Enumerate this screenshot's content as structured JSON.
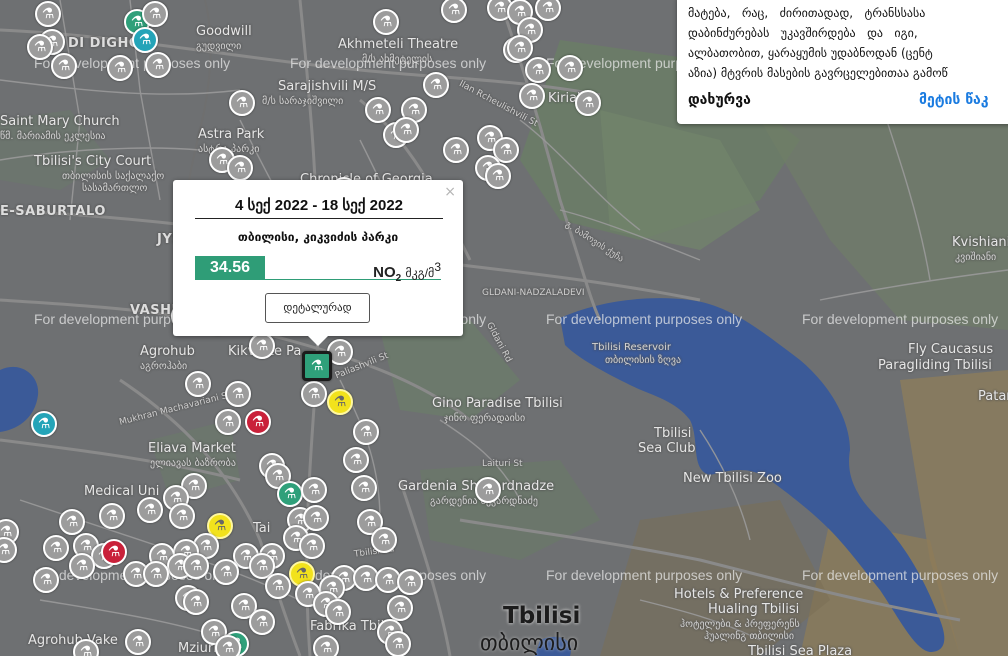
{
  "map": {
    "watermark_text": "For development purposes only",
    "labels": {
      "goodwill": "Goodwill",
      "goodwill_ka": "გუდვილი",
      "didi_dighomi": "DI DIGHO",
      "akhmeteli": "Akhmeteli Theatre",
      "akhmeteli_ka": "მ/ს ახმეტელის",
      "sarajishvili": "Sarajishvili M/S",
      "sarajishvili_ka": "მ/ს სარაჯიშვილი",
      "saint_mary": "Saint Mary Church",
      "saint_mary_ka": "წმ. მარიამის ეკლესია",
      "astra_park": "Astra Park",
      "astra_park_ka": "ასტრა პარკი",
      "city_court": "Tbilisi's City Court",
      "city_court_ka1": "თბილისის საქალაქო",
      "city_court_ka2": "სასამართლო",
      "chronicle": "Chronicle of Georgia",
      "saburtalo": "E-SABURTALO",
      "vashlijvari": "VASHLIJ",
      "jys": "JYS",
      "agrohub": "Agrohub",
      "agrohub_ka": "აგროჰაბი",
      "machavariani_st": "Mukhran Machavariani St",
      "eliava": "Eliava Market",
      "eliava_ka": "ელიავას ბაზრობა",
      "medical": "Medical Uni",
      "gldani": "GLDANI-NADZALADEVI",
      "reservoir": "Tbilisi Reservoir",
      "reservoir_ka": "თბილისის ზღვა",
      "gino": "Gino Paradise Tbilisi",
      "gino_ka": "ჯინო ფერადაისი",
      "sea_club": "Tbilisi",
      "sea_club2": "Sea Club",
      "new_zoo": "New Tbilisi Zoo",
      "laituri": "Laituri St",
      "gardenia": "Gardenia Shevardnadze",
      "gardenia_ka": "გარდენია შევარდნაძე",
      "tbilisi": "Tbilisi",
      "tbilisi_ka": "თბილისი",
      "hotels": "Hotels & Preference",
      "hualing": "Hualing Tbilisi",
      "hualing_ka1": "ჰოტელები & პრეფერენს",
      "hualing_ka2": "ჰუალინგ თბილისი",
      "fly_caucasus": "Fly Caucasus",
      "paragliding": "Paragliding Tbilisi",
      "kvishiani": "Kvishiani",
      "kvishiani_ka": "კვიშიანი",
      "patara": "Patar",
      "agrohub_vake": "Agrohub Vake",
      "mziuri": "Mziuri",
      "fabrika": "Fabrika Tbilisi",
      "reheul_st": "Ilan Rcheulishvili St",
      "ghrmgh": "Kiriaki",
      "tseri_st": "გ. ბამოვის ქუჩა",
      "sea_plaza": "Tbilisi Sea Plaza",
      "kikvidze": "Kikvidze Pa",
      "paliashvili": "Paliashvili St",
      "gldani_road": "Gldani Rd",
      "tai": "Tai",
      "tbilisi_road": "Tbilisi Rd"
    },
    "marker_glyph": "⚗"
  },
  "popup": {
    "date_range": "4 სექ 2022 - 18 სექ 2022",
    "location": "თბილისი, კიკვიძის პარკი",
    "value": "34.56",
    "pollutant": "NO",
    "pollutant_sub": "2",
    "unit": "მკგ/მ",
    "unit_sup": "3",
    "details_button": "დეტალურად",
    "close_glyph": "×",
    "value_color": "#2f9d77"
  },
  "info_panel": {
    "line1": "მატება,   რაც,   ძირითადად,   ტრანსსასა",
    "line2": "დაბინძურებას   უკავშირდება   და   იგი,",
    "line3": "ალბათობით, ყარაყუმის უდაბნოდან (ცენტ",
    "line4": "აზია) მტვრის მასების გავრცელებითაა გამოწ",
    "close_link": "დახურვა",
    "more_link": "მეტის წაკ"
  },
  "colors": {
    "map_bg": "#6e7072",
    "water": "#3b5a98",
    "park": "#5f7a5e",
    "desert": "#8a7c5c",
    "marker_gray": "#9c9c9c",
    "marker_teal": "#24a4b8",
    "marker_green": "#2fa07a",
    "marker_yellow": "#f2e21c",
    "marker_red": "#c9213a",
    "link_blue": "#1a7be0"
  }
}
